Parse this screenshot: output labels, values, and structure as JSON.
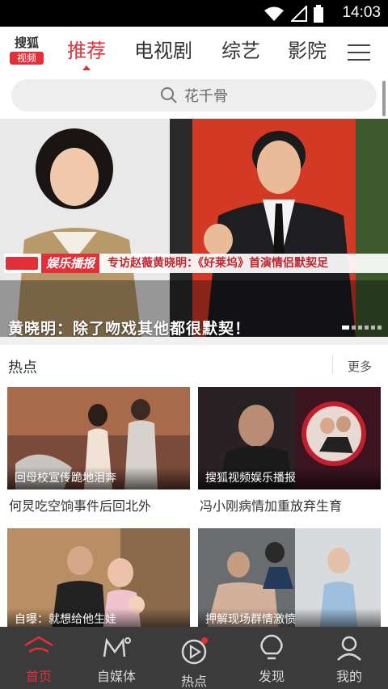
{
  "status_bar": {
    "time": "14:03"
  },
  "header": {
    "logo_top": "搜狐",
    "logo_bottom": "视频",
    "tabs": [
      {
        "label": "推荐",
        "active": true
      },
      {
        "label": "电视剧",
        "active": false
      },
      {
        "label": "综艺",
        "active": false
      },
      {
        "label": "影院",
        "active": false
      }
    ]
  },
  "search": {
    "placeholder": "花千骨"
  },
  "banner": {
    "title": "黄晓明：除了吻戏其他都很默契！",
    "strip_brand": "娱乐播报",
    "strip_text": "专访赵薇黄晓明：《好莱坞》首演情侣默契足",
    "dots_total": 6,
    "dot_active": 0
  },
  "hot_section": {
    "title": "热点",
    "more_label": "更多",
    "items": [
      {
        "caption": "回母校宣传跪地泪奔",
        "title": "何炅吃空饷事件后回北外"
      },
      {
        "caption": "搜狐视频娱乐播报",
        "title": "冯小刚病情加重放弃生育"
      },
      {
        "caption": "自曝：就想给他生娃",
        "title": ""
      },
      {
        "caption": "押解现场群情激愤",
        "title": ""
      }
    ]
  },
  "tab_bar": {
    "items": [
      {
        "label": "首页",
        "icon": "home-icon",
        "active": true
      },
      {
        "label": "自媒体",
        "icon": "we-media-icon",
        "active": false
      },
      {
        "label": "热点",
        "icon": "play-circle-icon",
        "active": false,
        "badge": true
      },
      {
        "label": "发现",
        "icon": "bulb-icon",
        "active": false
      },
      {
        "label": "我的",
        "icon": "user-icon",
        "active": false
      }
    ]
  },
  "colors": {
    "accent": "#e0303a",
    "tabbar_bg": "#3b3b3b",
    "search_bg": "#eeeeef"
  }
}
